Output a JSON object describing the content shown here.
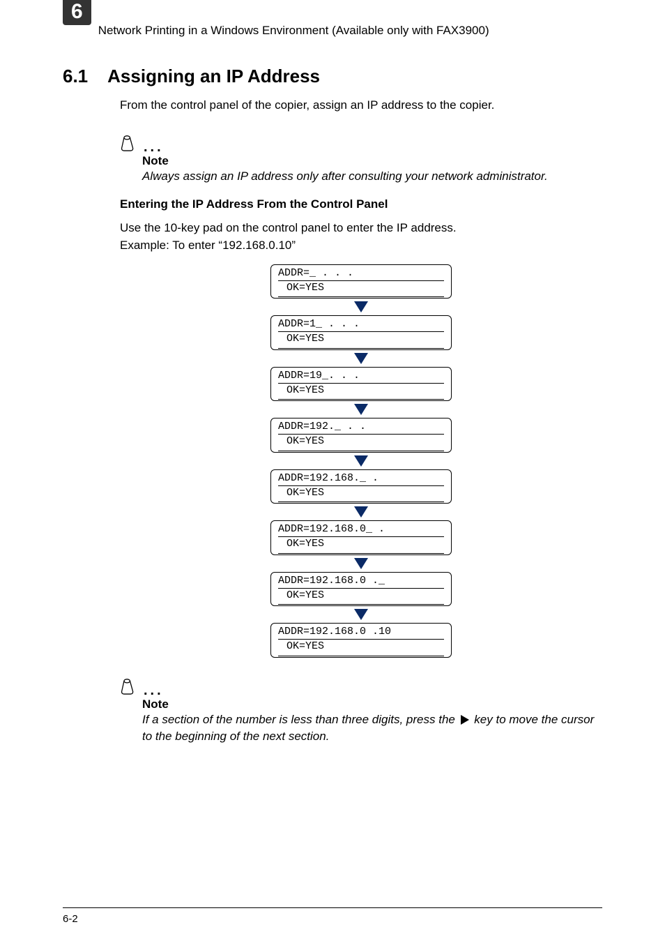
{
  "header": {
    "chapter": "6",
    "title": "Network Printing in a Windows Environment (Available only with FAX3900)"
  },
  "section": {
    "number": "6.1",
    "title": "Assigning an IP Address",
    "intro": "From the control panel of the copier, assign an IP address to the copier."
  },
  "note1": {
    "label": "Note",
    "body": "Always assign an IP address only after consulting your network administrator."
  },
  "sub": {
    "heading": "Entering the IP Address From the Control Panel",
    "line1": "Use the 10-key pad on the control panel to enter the IP address.",
    "line2": "Example: To enter “192.168.0.10”"
  },
  "lcds": [
    {
      "l1": "ADDR=_  .   .   .",
      "l2": "OK=YES"
    },
    {
      "l1": "ADDR=1_ .   .   .",
      "l2": "OK=YES"
    },
    {
      "l1": "ADDR=19_.   .   .",
      "l2": "OK=YES"
    },
    {
      "l1": "ADDR=192._  .   .",
      "l2": "OK=YES"
    },
    {
      "l1": "ADDR=192.168._  .",
      "l2": "OK=YES"
    },
    {
      "l1": "ADDR=192.168.0_ .",
      "l2": "OK=YES"
    },
    {
      "l1": "ADDR=192.168.0  ._",
      "l2": "OK=YES"
    },
    {
      "l1": "ADDR=192.168.0  .10",
      "l2": "OK=YES"
    }
  ],
  "note2": {
    "label": "Note",
    "body_pre": "If a section of the number is less than three digits, press the ",
    "body_post": " key to move the cursor to the beginning of the next section."
  },
  "footer": {
    "page": "6-2"
  }
}
